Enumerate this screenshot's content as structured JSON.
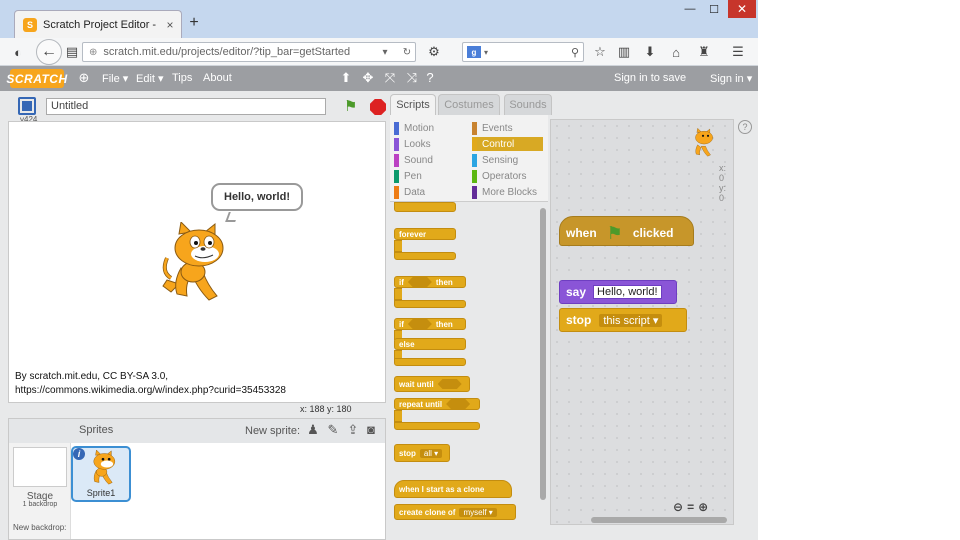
{
  "browser": {
    "tab_title": "Scratch Project Editor - Im...",
    "tab_close": "×",
    "new_tab": "+",
    "url": "scratch.mit.edu/projects/editor/?tip_bar=getStarted",
    "search_placeholder": "",
    "win_min": "—",
    "win_max": "☐",
    "win_close": "✕"
  },
  "menubar": {
    "logo": "SCRATCH",
    "file": "File ▾",
    "edit": "Edit ▾",
    "tips": "Tips",
    "about": "About",
    "sign_in_to_save": "Sign in to save",
    "sign_in": "Sign in ▾"
  },
  "stage": {
    "version": "v424",
    "project_title": "Untitled",
    "speech": "Hello, world!",
    "credit_line1": "By scratch.mit.edu, CC BY-SA 3.0,",
    "credit_line2": "https://commons.wikimedia.org/w/index.php?curid=35453328",
    "coords": "x: 188   y: 180"
  },
  "sprites": {
    "header": "Sprites",
    "new_sprite": "New sprite:",
    "stage_label": "Stage",
    "backdrop_count": "1 backdrop",
    "new_backdrop": "New backdrop:",
    "sprite1_name": "Sprite1",
    "info": "i"
  },
  "tabs": {
    "scripts": "Scripts",
    "costumes": "Costumes",
    "sounds": "Sounds"
  },
  "categories": [
    {
      "label": "Motion",
      "color": "#4a6cd4"
    },
    {
      "label": "Events",
      "color": "#c88330"
    },
    {
      "label": "Looks",
      "color": "#8a55d7"
    },
    {
      "label": "Control",
      "color": "#e1a91a"
    },
    {
      "label": "Sound",
      "color": "#bb42c3"
    },
    {
      "label": "Sensing",
      "color": "#2ca5e2"
    },
    {
      "label": "Pen",
      "color": "#0e9a6c"
    },
    {
      "label": "Operators",
      "color": "#5cb712"
    },
    {
      "label": "Data",
      "color": "#ee7d16"
    },
    {
      "label": "More Blocks",
      "color": "#632d99"
    }
  ],
  "palette": {
    "forever": "forever",
    "if": "if",
    "then": "then",
    "else": "else",
    "wait_until": "wait until",
    "repeat_until": "repeat until",
    "stop": "stop",
    "stop_all": "all ▾",
    "when_start_clone": "when I start as a clone",
    "create_clone": "create clone of",
    "myself": "myself ▾"
  },
  "script": {
    "when": "when",
    "clicked": "clicked",
    "say": "say",
    "say_text": "Hello, world!",
    "stop": "stop",
    "stop_option": "this script ▾",
    "x": "x: 0",
    "y": "y: 0",
    "help": "?"
  },
  "colors": {
    "control": "#e1a91a",
    "looks": "#8a55d7",
    "events": "#c7962a",
    "menubar": "#9c9ea2"
  }
}
